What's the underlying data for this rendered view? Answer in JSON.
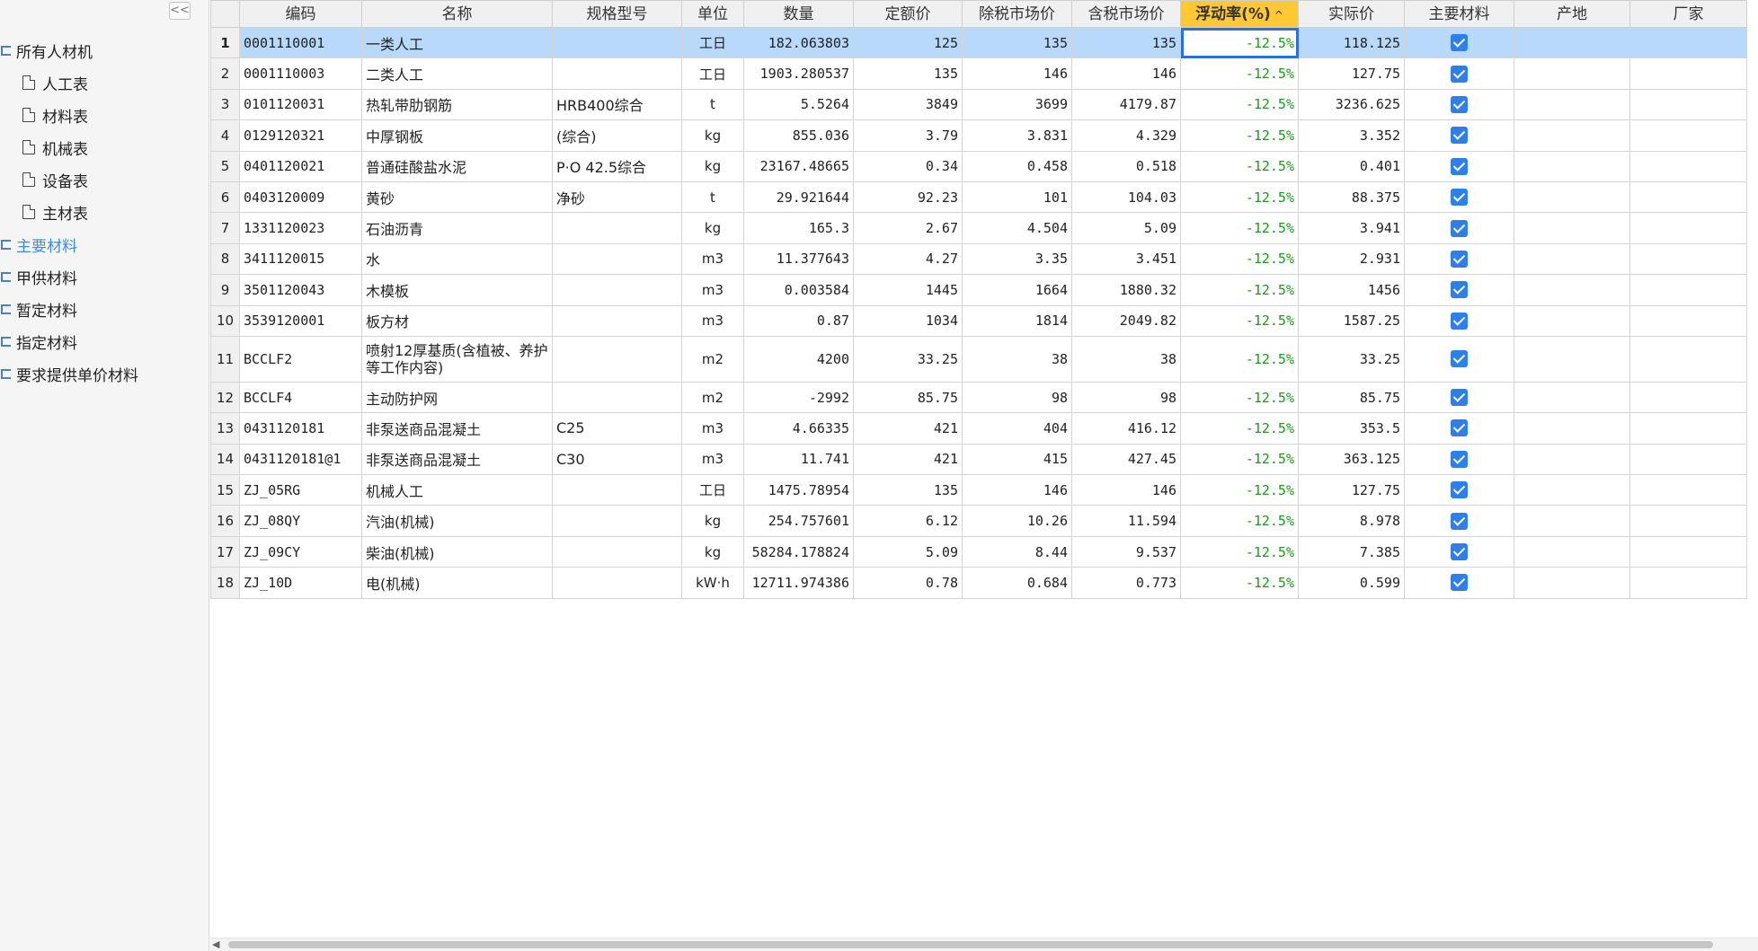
{
  "sidebar": {
    "collapse_label": "<<",
    "items": [
      {
        "label": "所有人材机",
        "type": "folder"
      },
      {
        "label": "人工表",
        "type": "doc"
      },
      {
        "label": "材料表",
        "type": "doc"
      },
      {
        "label": "机械表",
        "type": "doc"
      },
      {
        "label": "设备表",
        "type": "doc"
      },
      {
        "label": "主材表",
        "type": "doc"
      },
      {
        "label": "主要材料",
        "type": "folder",
        "selected": true
      },
      {
        "label": "甲供材料",
        "type": "folder"
      },
      {
        "label": "暂定材料",
        "type": "folder"
      },
      {
        "label": "指定材料",
        "type": "folder"
      },
      {
        "label": "要求提供单价材料",
        "type": "folder"
      }
    ]
  },
  "grid": {
    "columns": [
      "",
      "编码",
      "名称",
      "规格型号",
      "单位",
      "数量",
      "定额价",
      "除税市场价",
      "含税市场价",
      "浮动率(%)",
      "实际价",
      "主要材料",
      "产地",
      "厂家"
    ],
    "sorted_column_index": 9,
    "sort_icon": "^",
    "selected_row_index": 0,
    "rows": [
      [
        "1",
        "0001110001",
        "一类人工",
        "",
        "工日",
        "182.063803",
        "125",
        "135",
        "135",
        "-12.5%",
        "118.125",
        true,
        "",
        ""
      ],
      [
        "2",
        "0001110003",
        "二类人工",
        "",
        "工日",
        "1903.280537",
        "135",
        "146",
        "146",
        "-12.5%",
        "127.75",
        true,
        "",
        ""
      ],
      [
        "3",
        "0101120031",
        "热轧带肋钢筋",
        "HRB400综合",
        "t",
        "5.5264",
        "3849",
        "3699",
        "4179.87",
        "-12.5%",
        "3236.625",
        true,
        "",
        ""
      ],
      [
        "4",
        "0129120321",
        "中厚钢板",
        "(综合)",
        "kg",
        "855.036",
        "3.79",
        "3.831",
        "4.329",
        "-12.5%",
        "3.352",
        true,
        "",
        ""
      ],
      [
        "5",
        "0401120021",
        "普通硅酸盐水泥",
        "P·O 42.5综合",
        "kg",
        "23167.48665",
        "0.34",
        "0.458",
        "0.518",
        "-12.5%",
        "0.401",
        true,
        "",
        ""
      ],
      [
        "6",
        "0403120009",
        "黄砂",
        "净砂",
        "t",
        "29.921644",
        "92.23",
        "101",
        "104.03",
        "-12.5%",
        "88.375",
        true,
        "",
        ""
      ],
      [
        "7",
        "1331120023",
        "石油沥青",
        "",
        "kg",
        "165.3",
        "2.67",
        "4.504",
        "5.09",
        "-12.5%",
        "3.941",
        true,
        "",
        ""
      ],
      [
        "8",
        "3411120015",
        "水",
        "",
        "m3",
        "11.377643",
        "4.27",
        "3.35",
        "3.451",
        "-12.5%",
        "2.931",
        true,
        "",
        ""
      ],
      [
        "9",
        "3501120043",
        "木模板",
        "",
        "m3",
        "0.003584",
        "1445",
        "1664",
        "1880.32",
        "-12.5%",
        "1456",
        true,
        "",
        ""
      ],
      [
        "10",
        "3539120001",
        "板方材",
        "",
        "m3",
        "0.87",
        "1034",
        "1814",
        "2049.82",
        "-12.5%",
        "1587.25",
        true,
        "",
        ""
      ],
      [
        "11",
        "BCCLF2",
        "喷射12厚基质(含植被、养护等工作内容)",
        "",
        "m2",
        "4200",
        "33.25",
        "38",
        "38",
        "-12.5%",
        "33.25",
        true,
        "",
        ""
      ],
      [
        "12",
        "BCCLF4",
        "主动防护网",
        "",
        "m2",
        "-2992",
        "85.75",
        "98",
        "98",
        "-12.5%",
        "85.75",
        true,
        "",
        ""
      ],
      [
        "13",
        "0431120181",
        "非泵送商品混凝土",
        "C25",
        "m3",
        "4.66335",
        "421",
        "404",
        "416.12",
        "-12.5%",
        "353.5",
        true,
        "",
        ""
      ],
      [
        "14",
        "0431120181@1",
        "非泵送商品混凝土",
        "C30",
        "m3",
        "11.741",
        "421",
        "415",
        "427.45",
        "-12.5%",
        "363.125",
        true,
        "",
        ""
      ],
      [
        "15",
        "ZJ_05RG",
        "机械人工",
        "",
        "工日",
        "1475.78954",
        "135",
        "146",
        "146",
        "-12.5%",
        "127.75",
        true,
        "",
        ""
      ],
      [
        "16",
        "ZJ_08QY",
        "汽油(机械)",
        "",
        "kg",
        "254.757601",
        "6.12",
        "10.26",
        "11.594",
        "-12.5%",
        "8.978",
        true,
        "",
        ""
      ],
      [
        "17",
        "ZJ_09CY",
        "柴油(机械)",
        "",
        "kg",
        "58284.178824",
        "5.09",
        "8.44",
        "9.537",
        "-12.5%",
        "7.385",
        true,
        "",
        ""
      ],
      [
        "18",
        "ZJ_10D",
        "电(机械)",
        "",
        "kW·h",
        "12711.974386",
        "0.78",
        "0.684",
        "0.773",
        "-12.5%",
        "0.599",
        true,
        "",
        ""
      ]
    ]
  },
  "colors": {
    "accent": "#2f7fe8",
    "selected_row": "#b9d9fb",
    "sorted_header": "#ffc933",
    "rate_text": "#1a9a1a"
  }
}
